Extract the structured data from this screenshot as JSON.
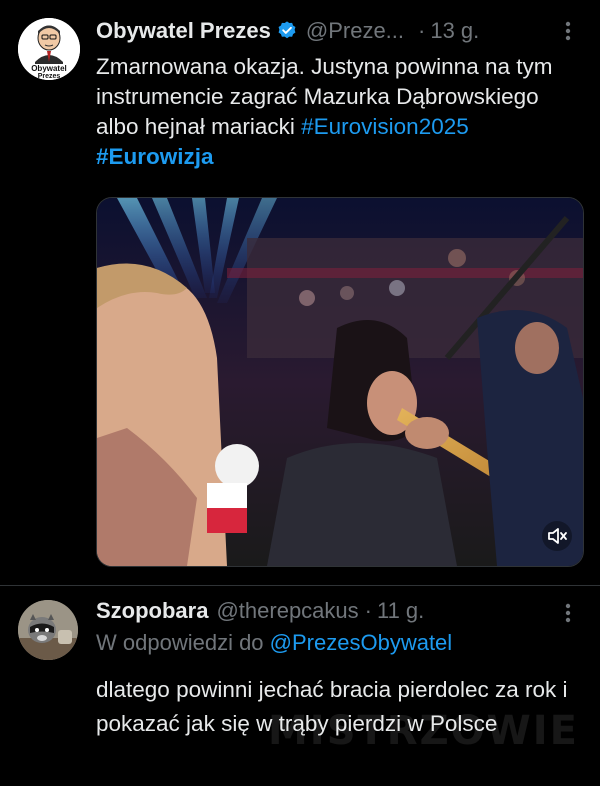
{
  "tweet1": {
    "display_name": "Obywatel Prezes",
    "handle": "@Preze...",
    "separator": "·",
    "time": "13 g.",
    "avatar_caption_line1": "Obywatel",
    "avatar_caption_line2": "Prezes",
    "text_main": "Zmarnowana okazja. Justyna powinna na tym instrumencie zagrać Mazurka Dąbrowskiego albo hejnał mariacki",
    "hashtag1": "#Eurovision2025",
    "hashtag2": "#Eurowizja",
    "media_icon": "speaker-muted-icon"
  },
  "tweet2": {
    "display_name": "Szopobara",
    "handle": "@therepcakus",
    "separator": "·",
    "time": "11 g.",
    "reply_prefix": "W odpowiedzi do",
    "reply_mention": "@PrezesObywatel",
    "text": "dlatego powinni jechać bracia pierdolec za rok i pokazać jak się w trąby pierdzi w Polsce"
  },
  "watermark": "MISTRZOWIE",
  "colors": {
    "background": "#000000",
    "text": "#e7e9ea",
    "secondary": "#71767b",
    "accent": "#1d9bf0",
    "divider": "#2f3336"
  }
}
